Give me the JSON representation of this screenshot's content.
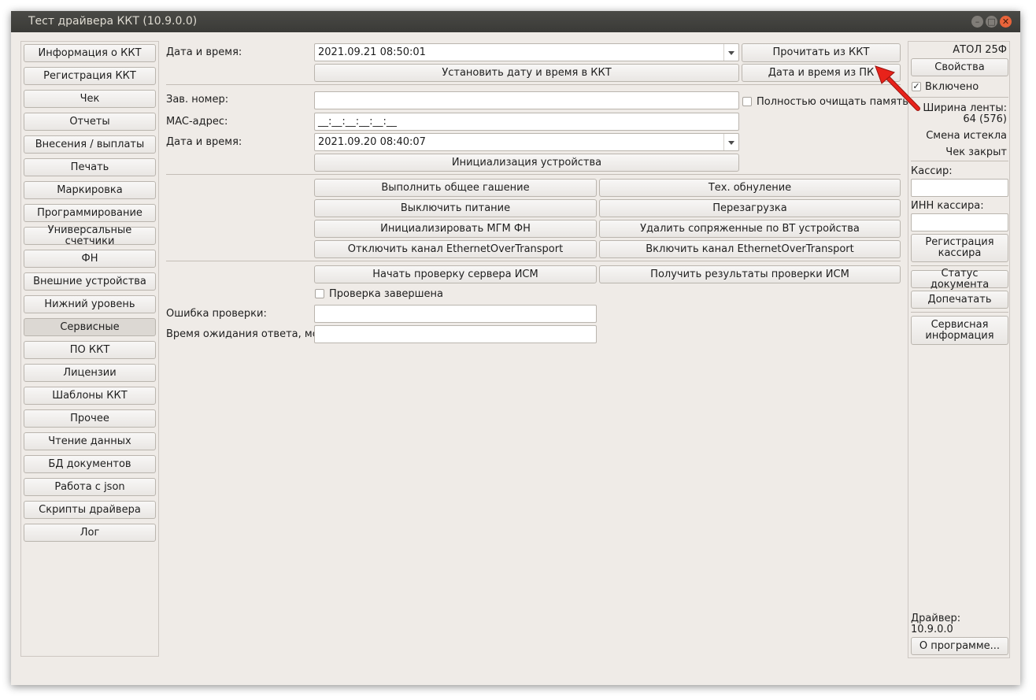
{
  "window": {
    "title": "Тест драйвера ККТ (10.9.0.0)"
  },
  "sidebar": {
    "items": [
      "Информация о ККТ",
      "Регистрация ККТ",
      "Чек",
      "Отчеты",
      "Внесения / выплаты",
      "Печать",
      "Маркировка",
      "Программирование",
      "Универсальные счетчики",
      "ФН",
      "Внешние устройства",
      "Нижний уровень",
      "Сервисные",
      "ПО ККТ",
      "Лицензии",
      "Шаблоны ККТ",
      "Прочее",
      "Чтение данных",
      "БД документов",
      "Работа с json",
      "Скрипты драйвера",
      "Лог"
    ],
    "active": "Сервисные"
  },
  "main": {
    "datetime_label": "Дата и время:",
    "datetime_value": "2021.09.21 08:50:01",
    "read_from_kkt": "Прочитать из ККТ",
    "set_datetime": "Установить дату и время в ККТ",
    "datetime_from_pc": "Дата и время из ПК",
    "serial_label": "Зав. номер:",
    "serial_value": "",
    "clear_memory_label": "Полностью очищать память",
    "mac_label": "MAC-адрес:",
    "mac_value": "__:__:__:__:__:__",
    "init_datetime_label": "Дата и время:",
    "init_datetime_value": "2021.09.20 08:40:07",
    "init_device": "Инициализация устройства",
    "general_reset": "Выполнить общее гашение",
    "tech_reset": "Тех. обнуление",
    "power_off": "Выключить питание",
    "reboot": "Перезагрузка",
    "init_mgm": "Инициализировать МГМ ФН",
    "remove_bt": "Удалить сопряженные по BT устройства",
    "disable_eot": "Отключить канал EthernetOverTransport",
    "enable_eot": "Включить канал EthernetOverTransport",
    "start_ism_check": "Начать проверку сервера ИСМ",
    "get_ism_results": "Получить результаты проверки ИСМ",
    "check_done_label": "Проверка завершена",
    "check_error_label": "Ошибка проверки:",
    "check_error_value": "",
    "timeout_label": "Время ожидания ответа, мс:",
    "timeout_value": ""
  },
  "right": {
    "model": "АТОЛ 25Ф",
    "properties": "Свойства",
    "enabled_label": "Включено",
    "enabled_mark": "✓",
    "tape_width_label": "Ширина ленты:",
    "tape_width_value": "64 (576)",
    "shift_status": "Смена истекла",
    "receipt_status": "Чек закрыт",
    "cashier_label": "Кассир:",
    "cashier_inn_label": "ИНН кассира:",
    "register_cashier": "Регистрация кассира",
    "doc_status": "Статус документа",
    "reprint": "Допечатать",
    "service_info": "Сервисная информация",
    "driver_label": "Драйвер:",
    "driver_version": "10.9.0.0",
    "about": "О программе..."
  },
  "colors": {
    "accent_arrow": "#e8221a",
    "close_button": "#e9643a"
  }
}
